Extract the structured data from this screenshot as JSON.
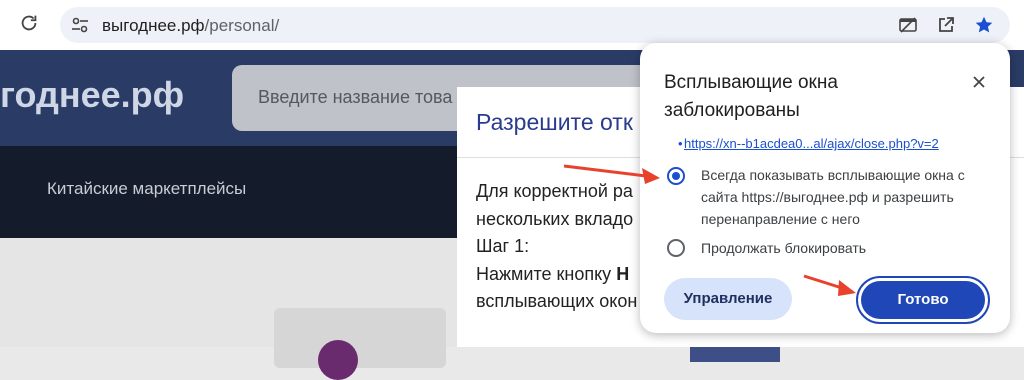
{
  "browser": {
    "url_host": "выгоднее.рф",
    "url_path": "/personal/",
    "icons": [
      "reload-icon",
      "site-settings-icon",
      "popup-blocked-icon",
      "open-in-new-icon",
      "bookmark-star-icon"
    ]
  },
  "site": {
    "logo_text": "годнее.рф",
    "search_placeholder": "Введите название това",
    "nav_item": "Китайские маркетплейсы"
  },
  "modal": {
    "title": "Разрешите отк",
    "lines": [
      "Для корректной ра",
      "нескольких вкладо",
      "Шаг 1:",
      "Нажмите кнопку "
    ],
    "bold_fragment": "Н",
    "line5": "всплывающих окон"
  },
  "popup_bubble": {
    "title": "Всплывающие окна заблокированы",
    "blocked_link": "https://xn--b1acdea0...al/ajax/close.php?v=2",
    "option_allow": "Всегда показывать всплывающие окна с сайта https://выгоднее.рф и разрешить перенаправление с него",
    "option_block": "Продолжать блокировать",
    "selected_option": "allow",
    "manage_label": "Управление",
    "done_label": "Готово"
  },
  "colors": {
    "accent": "#1f47b8",
    "annotation_arrow": "#e8412c",
    "site_header": "#2a3b66",
    "site_nav": "#141c2c"
  }
}
